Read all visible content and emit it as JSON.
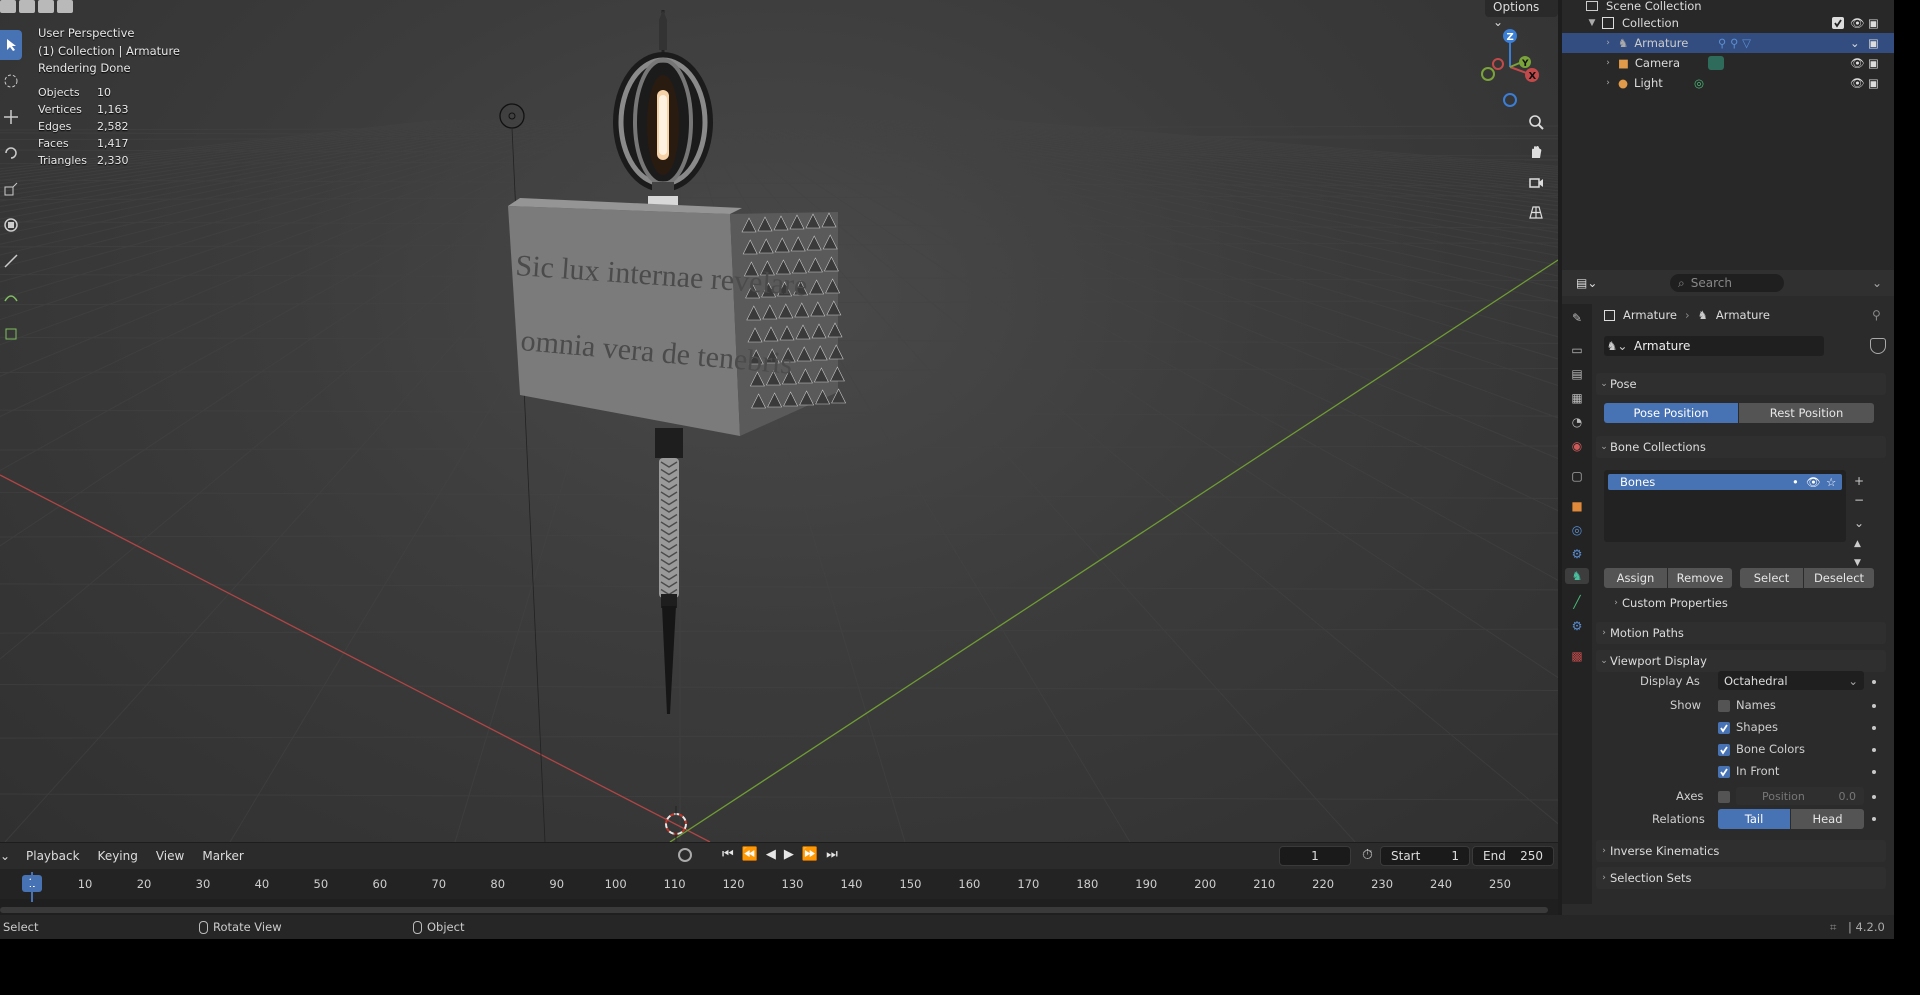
{
  "viewport": {
    "perspective": "User Perspective",
    "context": "(1) Collection | Armature",
    "status": "Rendering Done",
    "stats": [
      {
        "label": "Objects",
        "value": "10"
      },
      {
        "label": "Vertices",
        "value": "1,163"
      },
      {
        "label": "Edges",
        "value": "2,582"
      },
      {
        "label": "Faces",
        "value": "1,417"
      },
      {
        "label": "Triangles",
        "value": "2,330"
      }
    ],
    "options_label": "Options",
    "sign_text_line1": "Sic lux internae revelare",
    "sign_text_line2": "omnia vera de tenebris",
    "gizmo_axes": {
      "x": "X",
      "y": "Y",
      "z": "Z"
    },
    "colors": {
      "x_axis": "#c24a4a",
      "y_axis": "#7aa33a",
      "z_axis": "#3a7ed6"
    }
  },
  "timeline": {
    "menus": [
      "Playback",
      "Keying",
      "View",
      "Marker"
    ],
    "current_frame": "1",
    "start_label": "Start",
    "start_value": "1",
    "end_label": "End",
    "end_value": "250",
    "ruler_ticks": [
      "1",
      "10",
      "20",
      "30",
      "40",
      "50",
      "60",
      "70",
      "80",
      "90",
      "100",
      "110",
      "120",
      "130",
      "140",
      "150",
      "160",
      "170",
      "180",
      "190",
      "200",
      "210",
      "220",
      "230",
      "240",
      "250"
    ]
  },
  "statusbar": {
    "select": "Select",
    "rotate": "Rotate View",
    "object": "Object",
    "version": "4.2.0"
  },
  "outliner": {
    "scene_collection": "Scene Collection",
    "collection": "Collection",
    "items": [
      {
        "name": "Armature",
        "selected": true
      },
      {
        "name": "Camera",
        "selected": false
      },
      {
        "name": "Light",
        "selected": false
      }
    ]
  },
  "properties": {
    "search_placeholder": "Search",
    "breadcrumb_object": "Armature",
    "breadcrumb_data": "Armature",
    "datablock_name": "Armature",
    "pose_panel": "Pose",
    "pose_position": "Pose Position",
    "rest_position": "Rest Position",
    "bone_collections_panel": "Bone Collections",
    "bone_collection_item": "Bones",
    "assign": "Assign",
    "remove": "Remove",
    "select": "Select",
    "deselect": "Deselect",
    "custom_properties": "Custom Properties",
    "motion_paths": "Motion Paths",
    "viewport_display": "Viewport Display",
    "display_as_label": "Display As",
    "display_as_value": "Octahedral",
    "show_label": "Show",
    "show_names": "Names",
    "show_shapes": "Shapes",
    "show_bone_colors": "Bone Colors",
    "show_in_front": "In Front",
    "axes_label": "Axes",
    "axes_position_label": "Position",
    "axes_position_value": "0.0",
    "relations_label": "Relations",
    "relations_tail": "Tail",
    "relations_head": "Head",
    "inverse_kinematics": "Inverse Kinematics",
    "selection_sets": "Selection Sets",
    "checks": {
      "names": false,
      "shapes": true,
      "bone_colors": true,
      "in_front": true,
      "axes": false
    }
  }
}
